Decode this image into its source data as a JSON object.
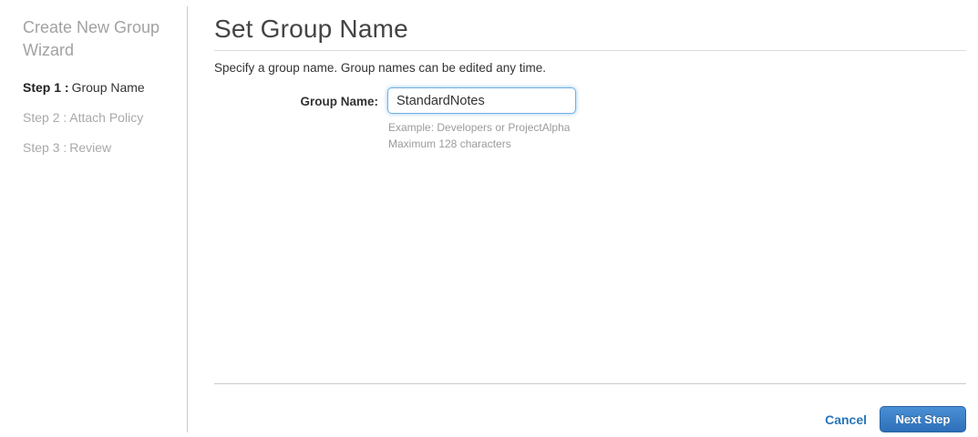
{
  "sidebar": {
    "title": "Create New Group Wizard",
    "steps": [
      {
        "prefix": "Step 1 :",
        "label": "Group Name"
      },
      {
        "prefix": "Step 2 :",
        "label": "Attach Policy"
      },
      {
        "prefix": "Step 3 :",
        "label": "Review"
      }
    ]
  },
  "main": {
    "title": "Set Group Name",
    "description": "Specify a group name. Group names can be edited any time.",
    "form": {
      "group_name_label": "Group Name:",
      "group_name_value": "StandardNotes",
      "hint_example": "Example: Developers or ProjectAlpha",
      "hint_max": "Maximum 128 characters"
    },
    "footer": {
      "cancel_label": "Cancel",
      "next_label": "Next Step"
    }
  },
  "colors": {
    "accent_blue": "#2976b8",
    "button_gradient_top": "#4a90d6",
    "button_gradient_bottom": "#2d6fb8",
    "input_focus_border": "#71b1e3",
    "muted_text": "#9b9b9b",
    "divider": "#cccccc"
  }
}
